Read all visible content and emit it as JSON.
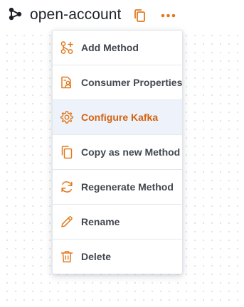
{
  "header": {
    "title": "open-account",
    "method_icon": "method-graph-icon",
    "copy_icon": "copy-icon",
    "more_icon": "more-horizontal-icon"
  },
  "menu": {
    "items": [
      {
        "label": "Add Method",
        "icon": "add-method-icon",
        "active": false
      },
      {
        "label": "Consumer Properties",
        "icon": "consumer-properties-icon",
        "active": false
      },
      {
        "label": "Configure Kafka",
        "icon": "gear-icon",
        "active": true
      },
      {
        "label": "Copy as new Method",
        "icon": "copy-icon",
        "active": false
      },
      {
        "label": "Regenerate Method",
        "icon": "regenerate-icon",
        "active": false
      },
      {
        "label": "Rename",
        "icon": "pencil-icon",
        "active": false
      },
      {
        "label": "Delete",
        "icon": "trash-icon",
        "active": false
      }
    ]
  },
  "colors": {
    "accent": "#e07a1f",
    "active_bg": "#eef3fb",
    "text": "#42474f"
  }
}
